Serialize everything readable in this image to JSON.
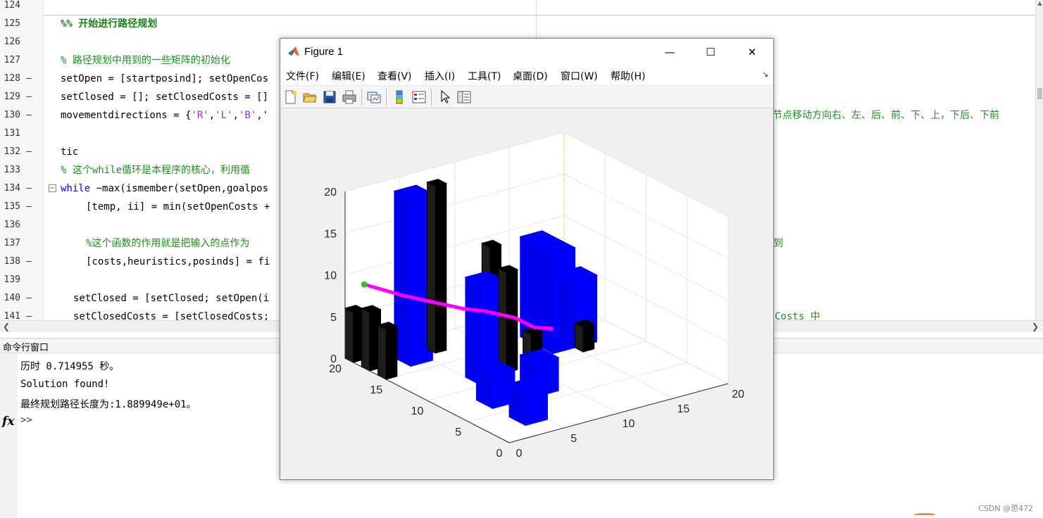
{
  "editor": {
    "lines": [
      {
        "num": "124",
        "mark": "",
        "text": ""
      },
      {
        "num": "125",
        "mark": "",
        "text": "%% 开始进行路径规划"
      },
      {
        "num": "126",
        "mark": "",
        "text": ""
      },
      {
        "num": "127",
        "mark": "",
        "text": "% 路径规划中用到的一些矩阵的初始化"
      },
      {
        "num": "128",
        "mark": "—",
        "text": "setOpen = [startposind]; setOpenCos"
      },
      {
        "num": "129",
        "mark": "—",
        "text": "setClosed = []; setClosedCosts = []"
      },
      {
        "num": "130",
        "mark": "—",
        "text": "movementdirections = {'R','L','B','"
      },
      {
        "num": "131",
        "mark": "",
        "text": ""
      },
      {
        "num": "132",
        "mark": "—",
        "text": "tic"
      },
      {
        "num": "133",
        "mark": "",
        "text": "% 这个while循环是本程序的核心，利用循"
      },
      {
        "num": "134",
        "mark": "—",
        "text_kw": "while",
        "text": " ~max(ismember(setOpen,goalpos"
      },
      {
        "num": "135",
        "mark": "—",
        "text": "[temp, ii] = min(setOpenCosts +"
      },
      {
        "num": "136",
        "mark": "",
        "text": ""
      },
      {
        "num": "137",
        "mark": "",
        "text": "%这个函数的作用就是把输入的点作为"
      },
      {
        "num": "138",
        "mark": "—",
        "text": "[costs,heuristics,posinds] = fi"
      },
      {
        "num": "139",
        "mark": "",
        "text": ""
      },
      {
        "num": "140",
        "mark": "—",
        "text": "setClosed = [setClosed; setOpen(i"
      },
      {
        "num": "141",
        "mark": "—",
        "text": "setClosedCosts = [setClosedCosts;"
      }
    ],
    "right_fragments": {
      "line130": "节点移动方向右、左、后、前、下、上，下后、下前",
      "line137": "到",
      "line141": "Costs 中"
    },
    "strings_line130": [
      "'R'",
      "'L'",
      "'B'"
    ]
  },
  "command_window": {
    "title": "命令行窗口",
    "output": [
      "历时 0.714955 秒。",
      "Solution found!",
      "最终规划路径长度为:1.889949e+01。"
    ],
    "fx_symbol": "fx",
    "prompt": ">>"
  },
  "figure": {
    "title": "Figure 1",
    "menus": [
      "文件(F)",
      "编辑(E)",
      "查看(V)",
      "插入(I)",
      "工具(T)",
      "桌面(D)",
      "窗口(W)",
      "帮助(H)"
    ],
    "window_controls": {
      "minimize": "—",
      "maximize": "☐",
      "close": "✕"
    },
    "toolbar_icons": [
      "new-figure-icon",
      "open-file-icon",
      "save-icon",
      "print-icon",
      "link-plot-icon",
      "colorbar-icon",
      "legend-icon",
      "pointer-icon",
      "property-inspector-icon"
    ]
  },
  "watermark": "CSDN @思472",
  "chart_data": {
    "type": "3d-bar",
    "xlim": [
      0,
      20
    ],
    "ylim": [
      0,
      20
    ],
    "zlim": [
      0,
      20
    ],
    "x_ticks": [
      "0",
      "5",
      "10",
      "15",
      "20"
    ],
    "y_ticks": [
      "0",
      "5",
      "10",
      "15",
      "20"
    ],
    "z_ticks": [
      "0",
      "5",
      "10",
      "15",
      "20"
    ],
    "grid": true,
    "colors": {
      "obstacle_blue": "#0000ff",
      "obstacle_black": "#000000",
      "path": "#ff00ff",
      "start": "#22cc22",
      "goal_line": "#ffd700"
    },
    "obstacles": [
      {
        "color": "blue",
        "x": 3,
        "y": 18,
        "w": 2,
        "d": 2,
        "h": 20
      },
      {
        "color": "black",
        "x": 6,
        "y": 18,
        "w": 1,
        "d": 1,
        "h": 20
      },
      {
        "color": "black",
        "x": 0,
        "y": 18,
        "w": 1,
        "d": 1,
        "h": 7
      },
      {
        "color": "black",
        "x": 0,
        "y": 16,
        "w": 1,
        "d": 1,
        "h": 6
      },
      {
        "color": "black",
        "x": 0,
        "y": 20,
        "w": 1,
        "d": 1,
        "h": 6
      },
      {
        "color": "blue",
        "x": 5,
        "y": 12,
        "w": 2,
        "d": 2,
        "h": 12
      },
      {
        "color": "black",
        "x": 8,
        "y": 14,
        "w": 1,
        "d": 1,
        "h": 14
      },
      {
        "color": "black",
        "x": 8,
        "y": 12,
        "w": 1,
        "d": 1,
        "h": 12
      },
      {
        "color": "blue",
        "x": 13,
        "y": 16,
        "w": 2,
        "d": 2,
        "h": 12
      },
      {
        "color": "blue",
        "x": 13,
        "y": 14,
        "w": 2,
        "d": 2,
        "h": 12
      },
      {
        "color": "blue",
        "x": 15,
        "y": 14,
        "w": 2,
        "d": 2,
        "h": 8
      },
      {
        "color": "black",
        "x": 11,
        "y": 13,
        "w": 1,
        "d": 1,
        "h": 3
      },
      {
        "color": "black",
        "x": 15,
        "y": 12,
        "w": 1,
        "d": 1,
        "h": 3
      },
      {
        "color": "blue",
        "x": 3,
        "y": 8,
        "w": 2,
        "d": 2,
        "h": 4
      },
      {
        "color": "blue",
        "x": 3,
        "y": 4,
        "w": 2,
        "d": 2,
        "h": 4
      },
      {
        "color": "blue",
        "x": 7,
        "y": 8,
        "w": 2,
        "d": 2,
        "h": 4
      },
      {
        "color": "black",
        "x": 5,
        "y": 6,
        "w": 1,
        "d": 1,
        "h": 1
      }
    ],
    "path": [
      [
        1,
        19,
        9
      ],
      [
        3,
        17,
        8
      ],
      [
        5,
        16,
        7
      ],
      [
        7,
        15,
        6
      ],
      [
        9,
        15,
        5
      ],
      [
        11,
        14,
        4
      ],
      [
        12,
        13,
        3
      ],
      [
        13,
        12,
        3
      ]
    ],
    "start": [
      1,
      19,
      9
    ],
    "goal": [
      20,
      20,
      20
    ]
  }
}
